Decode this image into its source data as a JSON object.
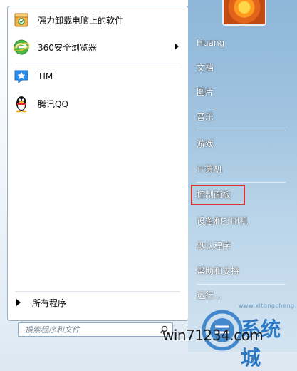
{
  "left": {
    "programs": [
      {
        "label": "强力卸载电脑上的软件",
        "icon": "uninstall-box-icon",
        "has_submenu": false
      },
      {
        "label": "360安全浏览器",
        "icon": "360-browser-icon",
        "has_submenu": true
      },
      {
        "label": "TIM",
        "icon": "tim-icon",
        "has_submenu": false
      },
      {
        "label": "腾讯QQ",
        "icon": "qq-penguin-icon",
        "has_submenu": false
      }
    ],
    "all_programs": "所有程序",
    "search_placeholder": "搜索程序和文件"
  },
  "right": {
    "user_name": "Huang",
    "items": [
      "文档",
      "图片",
      "音乐",
      "游戏",
      "计算机",
      "控制面板",
      "设备和打印机",
      "默认程序",
      "帮助和支持",
      "运行..."
    ],
    "highlighted": "控制面板"
  },
  "watermark": {
    "text": "win71234.com",
    "big": "系统城",
    "url": "www.xitongcheng.com"
  },
  "colors": {
    "highlight_border": "#e2302f",
    "right_pane": "#9ec2df"
  }
}
